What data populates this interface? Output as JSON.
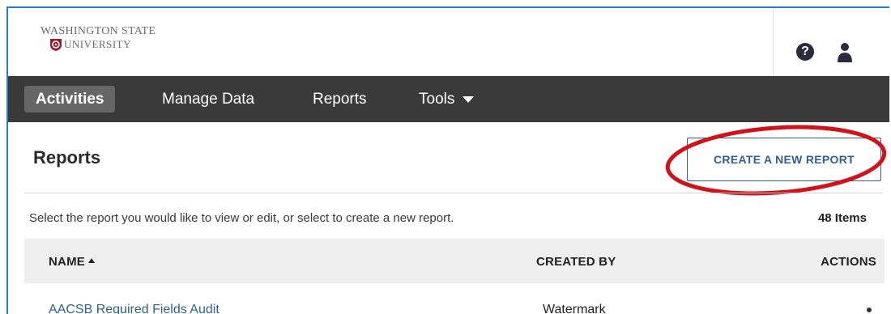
{
  "header": {
    "logo_line1": "WASHINGTON STATE",
    "logo_line2": "UNIVERSITY",
    "help_symbol": "?",
    "icons": [
      "help-icon",
      "user-icon"
    ],
    "logo_color": "#981e32"
  },
  "nav": {
    "items": [
      {
        "label": "Activities",
        "active": true
      },
      {
        "label": "Manage Data",
        "active": false
      },
      {
        "label": "Reports",
        "active": false
      },
      {
        "label": "Tools",
        "active": false
      }
    ]
  },
  "page": {
    "title": "Reports",
    "create_button": "CREATE A NEW REPORT",
    "hint": "Select the report you would like to view or edit, or select to create a new report.",
    "item_count": "48 Items",
    "highlight_color": "#d0121b",
    "accent_color": "#2f5f96"
  },
  "table": {
    "columns": [
      "NAME",
      "CREATED BY",
      "ACTIONS"
    ],
    "sorted_column": "NAME",
    "rows": [
      {
        "name": "AACSB Required Fields Audit",
        "created_by": "Watermark"
      }
    ]
  }
}
